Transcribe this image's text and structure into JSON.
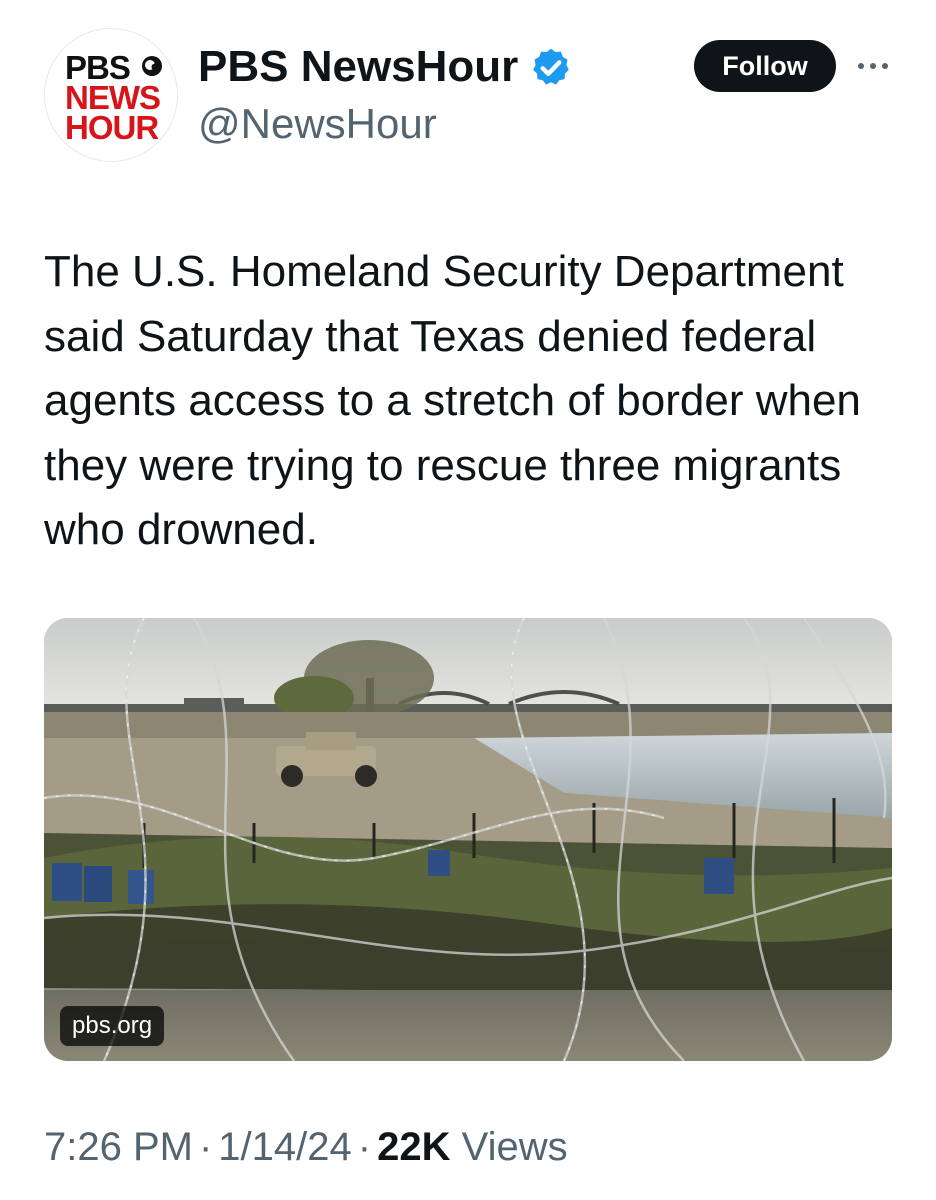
{
  "account": {
    "logo_lines": [
      "PBS",
      "NEWS",
      "HOUR"
    ],
    "display_name": "PBS NewsHour",
    "handle": "@NewsHour",
    "verified_color": "#1d9bf0"
  },
  "actions": {
    "follow_label": "Follow"
  },
  "tweet": {
    "text": "The U.S. Homeland Security Department said Saturday that Texas denied federal agents access to a stretch of border when they were trying to rescue three migrants who drowned."
  },
  "media": {
    "domain": "pbs.org"
  },
  "meta": {
    "time": "7:26 PM",
    "separator": "·",
    "date": "1/14/24",
    "views_count": "22K",
    "views_label": "Views"
  },
  "colors": {
    "text": "#0f1419",
    "secondary": "#536471",
    "button_bg": "#0f1419",
    "logo_red": "#d7141a"
  }
}
